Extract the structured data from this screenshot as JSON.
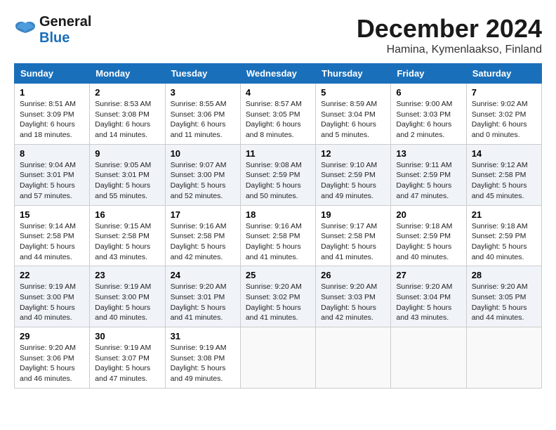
{
  "header": {
    "logo_general": "General",
    "logo_blue": "Blue",
    "month": "December 2024",
    "location": "Hamina, Kymenlaakso, Finland"
  },
  "days_of_week": [
    "Sunday",
    "Monday",
    "Tuesday",
    "Wednesday",
    "Thursday",
    "Friday",
    "Saturday"
  ],
  "weeks": [
    [
      {
        "day": "1",
        "sunrise": "Sunrise: 8:51 AM",
        "sunset": "Sunset: 3:09 PM",
        "daylight": "Daylight: 6 hours and 18 minutes."
      },
      {
        "day": "2",
        "sunrise": "Sunrise: 8:53 AM",
        "sunset": "Sunset: 3:08 PM",
        "daylight": "Daylight: 6 hours and 14 minutes."
      },
      {
        "day": "3",
        "sunrise": "Sunrise: 8:55 AM",
        "sunset": "Sunset: 3:06 PM",
        "daylight": "Daylight: 6 hours and 11 minutes."
      },
      {
        "day": "4",
        "sunrise": "Sunrise: 8:57 AM",
        "sunset": "Sunset: 3:05 PM",
        "daylight": "Daylight: 6 hours and 8 minutes."
      },
      {
        "day": "5",
        "sunrise": "Sunrise: 8:59 AM",
        "sunset": "Sunset: 3:04 PM",
        "daylight": "Daylight: 6 hours and 5 minutes."
      },
      {
        "day": "6",
        "sunrise": "Sunrise: 9:00 AM",
        "sunset": "Sunset: 3:03 PM",
        "daylight": "Daylight: 6 hours and 2 minutes."
      },
      {
        "day": "7",
        "sunrise": "Sunrise: 9:02 AM",
        "sunset": "Sunset: 3:02 PM",
        "daylight": "Daylight: 6 hours and 0 minutes."
      }
    ],
    [
      {
        "day": "8",
        "sunrise": "Sunrise: 9:04 AM",
        "sunset": "Sunset: 3:01 PM",
        "daylight": "Daylight: 5 hours and 57 minutes."
      },
      {
        "day": "9",
        "sunrise": "Sunrise: 9:05 AM",
        "sunset": "Sunset: 3:01 PM",
        "daylight": "Daylight: 5 hours and 55 minutes."
      },
      {
        "day": "10",
        "sunrise": "Sunrise: 9:07 AM",
        "sunset": "Sunset: 3:00 PM",
        "daylight": "Daylight: 5 hours and 52 minutes."
      },
      {
        "day": "11",
        "sunrise": "Sunrise: 9:08 AM",
        "sunset": "Sunset: 2:59 PM",
        "daylight": "Daylight: 5 hours and 50 minutes."
      },
      {
        "day": "12",
        "sunrise": "Sunrise: 9:10 AM",
        "sunset": "Sunset: 2:59 PM",
        "daylight": "Daylight: 5 hours and 49 minutes."
      },
      {
        "day": "13",
        "sunrise": "Sunrise: 9:11 AM",
        "sunset": "Sunset: 2:59 PM",
        "daylight": "Daylight: 5 hours and 47 minutes."
      },
      {
        "day": "14",
        "sunrise": "Sunrise: 9:12 AM",
        "sunset": "Sunset: 2:58 PM",
        "daylight": "Daylight: 5 hours and 45 minutes."
      }
    ],
    [
      {
        "day": "15",
        "sunrise": "Sunrise: 9:14 AM",
        "sunset": "Sunset: 2:58 PM",
        "daylight": "Daylight: 5 hours and 44 minutes."
      },
      {
        "day": "16",
        "sunrise": "Sunrise: 9:15 AM",
        "sunset": "Sunset: 2:58 PM",
        "daylight": "Daylight: 5 hours and 43 minutes."
      },
      {
        "day": "17",
        "sunrise": "Sunrise: 9:16 AM",
        "sunset": "Sunset: 2:58 PM",
        "daylight": "Daylight: 5 hours and 42 minutes."
      },
      {
        "day": "18",
        "sunrise": "Sunrise: 9:16 AM",
        "sunset": "Sunset: 2:58 PM",
        "daylight": "Daylight: 5 hours and 41 minutes."
      },
      {
        "day": "19",
        "sunrise": "Sunrise: 9:17 AM",
        "sunset": "Sunset: 2:58 PM",
        "daylight": "Daylight: 5 hours and 41 minutes."
      },
      {
        "day": "20",
        "sunrise": "Sunrise: 9:18 AM",
        "sunset": "Sunset: 2:59 PM",
        "daylight": "Daylight: 5 hours and 40 minutes."
      },
      {
        "day": "21",
        "sunrise": "Sunrise: 9:18 AM",
        "sunset": "Sunset: 2:59 PM",
        "daylight": "Daylight: 5 hours and 40 minutes."
      }
    ],
    [
      {
        "day": "22",
        "sunrise": "Sunrise: 9:19 AM",
        "sunset": "Sunset: 3:00 PM",
        "daylight": "Daylight: 5 hours and 40 minutes."
      },
      {
        "day": "23",
        "sunrise": "Sunrise: 9:19 AM",
        "sunset": "Sunset: 3:00 PM",
        "daylight": "Daylight: 5 hours and 40 minutes."
      },
      {
        "day": "24",
        "sunrise": "Sunrise: 9:20 AM",
        "sunset": "Sunset: 3:01 PM",
        "daylight": "Daylight: 5 hours and 41 minutes."
      },
      {
        "day": "25",
        "sunrise": "Sunrise: 9:20 AM",
        "sunset": "Sunset: 3:02 PM",
        "daylight": "Daylight: 5 hours and 41 minutes."
      },
      {
        "day": "26",
        "sunrise": "Sunrise: 9:20 AM",
        "sunset": "Sunset: 3:03 PM",
        "daylight": "Daylight: 5 hours and 42 minutes."
      },
      {
        "day": "27",
        "sunrise": "Sunrise: 9:20 AM",
        "sunset": "Sunset: 3:04 PM",
        "daylight": "Daylight: 5 hours and 43 minutes."
      },
      {
        "day": "28",
        "sunrise": "Sunrise: 9:20 AM",
        "sunset": "Sunset: 3:05 PM",
        "daylight": "Daylight: 5 hours and 44 minutes."
      }
    ],
    [
      {
        "day": "29",
        "sunrise": "Sunrise: 9:20 AM",
        "sunset": "Sunset: 3:06 PM",
        "daylight": "Daylight: 5 hours and 46 minutes."
      },
      {
        "day": "30",
        "sunrise": "Sunrise: 9:19 AM",
        "sunset": "Sunset: 3:07 PM",
        "daylight": "Daylight: 5 hours and 47 minutes."
      },
      {
        "day": "31",
        "sunrise": "Sunrise: 9:19 AM",
        "sunset": "Sunset: 3:08 PM",
        "daylight": "Daylight: 5 hours and 49 minutes."
      },
      null,
      null,
      null,
      null
    ]
  ]
}
